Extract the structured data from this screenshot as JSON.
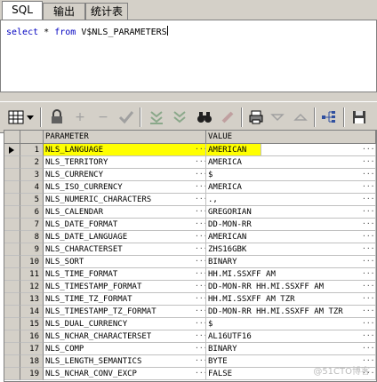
{
  "tabs": [
    {
      "label": "SQL"
    },
    {
      "label": "输出"
    },
    {
      "label": "统计表"
    }
  ],
  "editor": {
    "kw_select": "select",
    "star": "*",
    "kw_from": "from",
    "table": "V$NLS_PARAMETERS"
  },
  "toolbar": {
    "icons": [
      "grid-icon",
      "dropdown-icon",
      "lock-icon",
      "add-icon",
      "remove-icon",
      "check-icon",
      "down-arrows-icon",
      "down-arrows-icon",
      "binoculars-icon",
      "clear-icon",
      "print-icon",
      "down-triangle-icon",
      "up-triangle-icon",
      "tree-icon",
      "save-icon"
    ]
  },
  "grid": {
    "headers": {
      "col1": "PARAMETER",
      "col2": "VALUE"
    },
    "highlight_color": "#ffff00",
    "rows": [
      {
        "num": "1",
        "param": "NLS_LANGUAGE",
        "value": "AMERICAN"
      },
      {
        "num": "2",
        "param": "NLS_TERRITORY",
        "value": "AMERICA"
      },
      {
        "num": "3",
        "param": "NLS_CURRENCY",
        "value": "$"
      },
      {
        "num": "4",
        "param": "NLS_ISO_CURRENCY",
        "value": "AMERICA"
      },
      {
        "num": "5",
        "param": "NLS_NUMERIC_CHARACTERS",
        "value": ".,"
      },
      {
        "num": "6",
        "param": "NLS_CALENDAR",
        "value": "GREGORIAN"
      },
      {
        "num": "7",
        "param": "NLS_DATE_FORMAT",
        "value": "DD-MON-RR"
      },
      {
        "num": "8",
        "param": "NLS_DATE_LANGUAGE",
        "value": "AMERICAN"
      },
      {
        "num": "9",
        "param": "NLS_CHARACTERSET",
        "value": "ZHS16GBK"
      },
      {
        "num": "10",
        "param": "NLS_SORT",
        "value": "BINARY"
      },
      {
        "num": "11",
        "param": "NLS_TIME_FORMAT",
        "value": "HH.MI.SSXFF AM"
      },
      {
        "num": "12",
        "param": "NLS_TIMESTAMP_FORMAT",
        "value": "DD-MON-RR HH.MI.SSXFF AM"
      },
      {
        "num": "13",
        "param": "NLS_TIME_TZ_FORMAT",
        "value": "HH.MI.SSXFF AM TZR"
      },
      {
        "num": "14",
        "param": "NLS_TIMESTAMP_TZ_FORMAT",
        "value": "DD-MON-RR HH.MI.SSXFF AM TZR"
      },
      {
        "num": "15",
        "param": "NLS_DUAL_CURRENCY",
        "value": "$"
      },
      {
        "num": "16",
        "param": "NLS_NCHAR_CHARACTERSET",
        "value": "AL16UTF16"
      },
      {
        "num": "17",
        "param": "NLS_COMP",
        "value": "BINARY"
      },
      {
        "num": "18",
        "param": "NLS_LENGTH_SEMANTICS",
        "value": "BYTE"
      },
      {
        "num": "19",
        "param": "NLS_NCHAR_CONV_EXCP",
        "value": "FALSE"
      }
    ]
  },
  "watermark": "@51CTO博客"
}
